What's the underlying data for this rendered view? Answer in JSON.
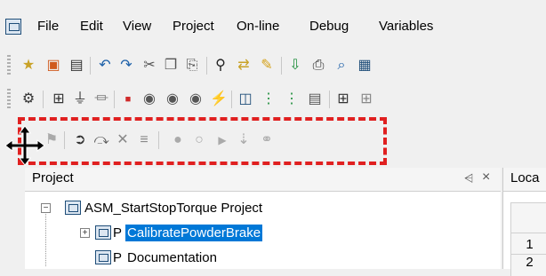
{
  "menu": {
    "items": [
      "File",
      "Edit",
      "View",
      "Project",
      "On-line",
      "Debug",
      "Variables"
    ]
  },
  "panel": {
    "title": "Project",
    "pin": "⩤",
    "close": "×"
  },
  "local_panel": {
    "title": "Loca"
  },
  "tree": {
    "root": "ASM_StartStopTorque Project",
    "items": [
      {
        "prefix": "P",
        "label": "CalibratePowderBrake",
        "selected": true
      },
      {
        "prefix": "P",
        "label": "Documentation",
        "selected": false
      }
    ]
  },
  "grid": {
    "row_labels": [
      "1",
      "2"
    ]
  },
  "colors": {
    "highlight_dash": "#e02020",
    "selection": "#0078d7"
  }
}
